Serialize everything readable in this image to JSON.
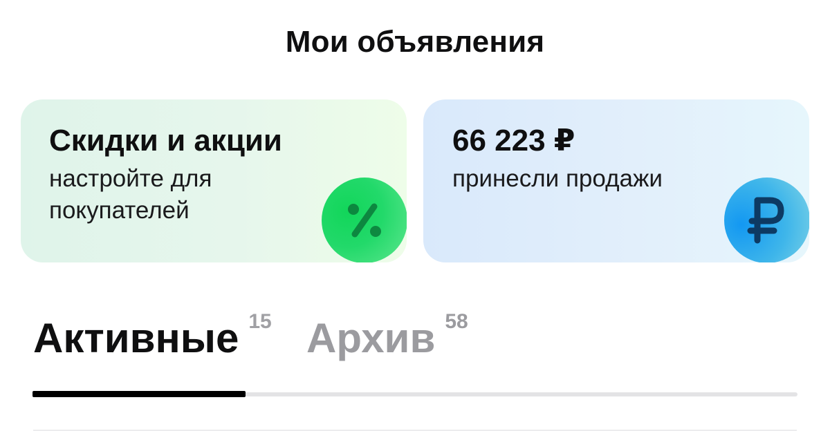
{
  "header": {
    "title": "Мои объявления"
  },
  "cards": {
    "discounts": {
      "title": "Скидки и акции",
      "subtitle": "настройте для покупателей",
      "icon": "percent-icon",
      "accent": "#22d96a"
    },
    "sales": {
      "title": "66 223 ₽",
      "subtitle": "принесли продажи",
      "icon": "ruble-icon",
      "accent": "#1398f2"
    }
  },
  "tabs": [
    {
      "label": "Активные",
      "count": "15",
      "active": true
    },
    {
      "label": "Архив",
      "count": "58",
      "active": false
    }
  ]
}
